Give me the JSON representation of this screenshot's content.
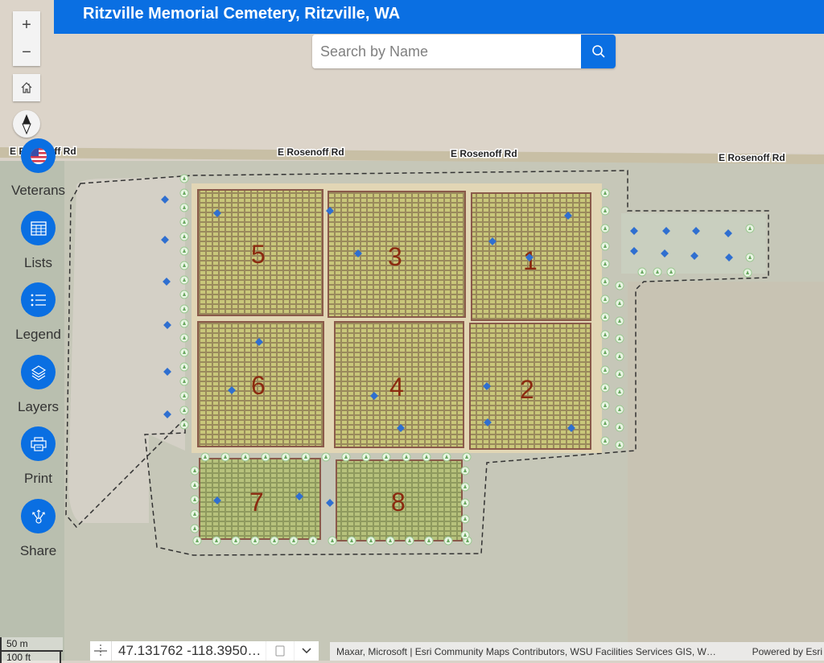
{
  "header": {
    "title": "Ritzville Memorial Cemetery, Ritzville, WA"
  },
  "search": {
    "placeholder": "Search by Name",
    "value": "",
    "button_icon": "search-icon"
  },
  "map_controls": {
    "zoom_in": "+",
    "zoom_out": "−",
    "home_icon": "home-icon",
    "compass_icon": "compass-icon"
  },
  "tools": [
    {
      "label": "Veterans",
      "icon": "us-flag-icon"
    },
    {
      "label": "Lists",
      "icon": "table-icon"
    },
    {
      "label": "Legend",
      "icon": "list-icon"
    },
    {
      "label": "Layers",
      "icon": "layers-icon"
    },
    {
      "label": "Print",
      "icon": "printer-icon"
    },
    {
      "label": "Share",
      "icon": "share-icon"
    }
  ],
  "map": {
    "road_labels": [
      "E Rosenoff Rd",
      "E Rosenoff Rd",
      "E Rosenoff Rd",
      "E Rosenoff Rd"
    ],
    "sections": [
      "1",
      "2",
      "3",
      "4",
      "5",
      "6",
      "7",
      "8"
    ],
    "colors": {
      "accent": "#0a6fe2",
      "section_label": "#8b2a10",
      "plot_fill": "#b8bd6a",
      "marker_blue": "#2f6fd0",
      "tree_marker": "#e9f5e4"
    }
  },
  "footer": {
    "scale_metric": "50 m",
    "scale_imperial": "100 ft",
    "coordinates": "47.131762 -118.3950…",
    "attribution": "Maxar, Microsoft | Esri Community Maps Contributors, WSU Facilities Services GIS, W…",
    "powered_by": "Powered by Esri"
  }
}
